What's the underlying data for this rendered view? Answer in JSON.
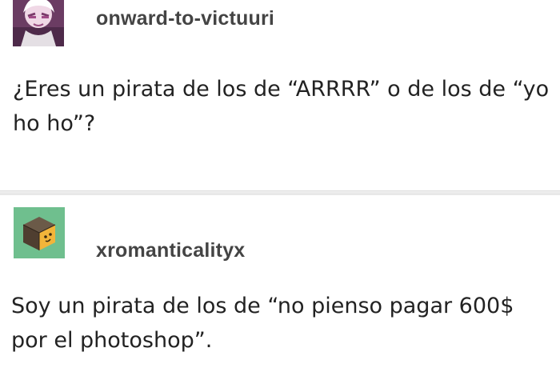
{
  "posts": [
    {
      "username": "onward-to-victuuri",
      "avatar_icon": "anime-character-avatar-icon",
      "text": "¿Eres un pirata de los de “ARRRR” o de los de “yo ho ho”?"
    },
    {
      "username": "xromanticalityx",
      "avatar_icon": "cube-avatar-icon",
      "text": "Soy un pirata de los de “no pienso pagar 600$ por el photoshop”."
    }
  ],
  "colors": {
    "background": "#ffffff",
    "username": "#444444",
    "body_text": "#222222",
    "avatar2_bg": "#6fbf8e",
    "divider": "#e6e6e6"
  }
}
